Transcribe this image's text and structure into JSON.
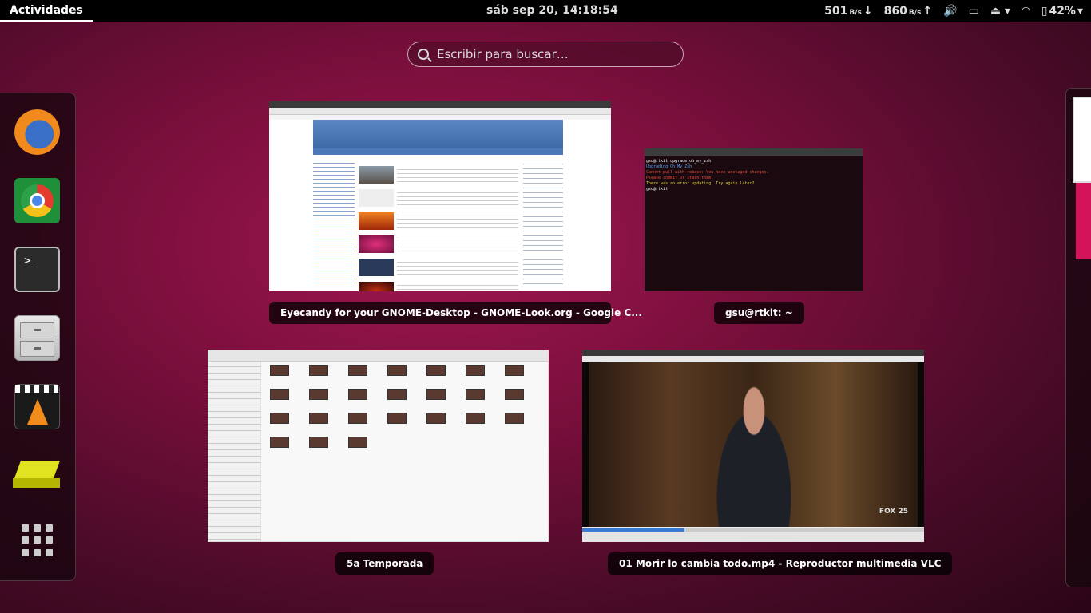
{
  "topbar": {
    "activities": "Actividades",
    "clock": "sáb sep 20, 14:18:54",
    "net_down_value": "501",
    "net_down_unit": "B/s",
    "net_up_value": "860",
    "net_up_unit": "B/s",
    "battery": "42%"
  },
  "search": {
    "placeholder": "Escribir para buscar…"
  },
  "dash": {
    "items": [
      "firefox",
      "chrome",
      "terminal",
      "files",
      "vlc",
      "removable-drive",
      "show-applications"
    ]
  },
  "windows": {
    "browser": {
      "label": "Eyecandy for your GNOME-Desktop - GNOME-Look.org - Google C..."
    },
    "terminal": {
      "label": "gsu@rtkit: ~",
      "lines": [
        "gsu@rtkit  upgrade_oh_my_zsh",
        "Upgrading Oh My Zsh",
        "Cannot pull with rebase: You have unstaged changes.",
        "Please commit or stash them.",
        "There was an error updating. Try again later?",
        "gsu@rtkit  "
      ]
    },
    "files": {
      "label": "5a Temporada"
    },
    "vlc": {
      "label": "01 Morir lo cambia todo.mp4 - Reproductor multimedia VLC",
      "channel_logo": "FOX 25"
    }
  }
}
